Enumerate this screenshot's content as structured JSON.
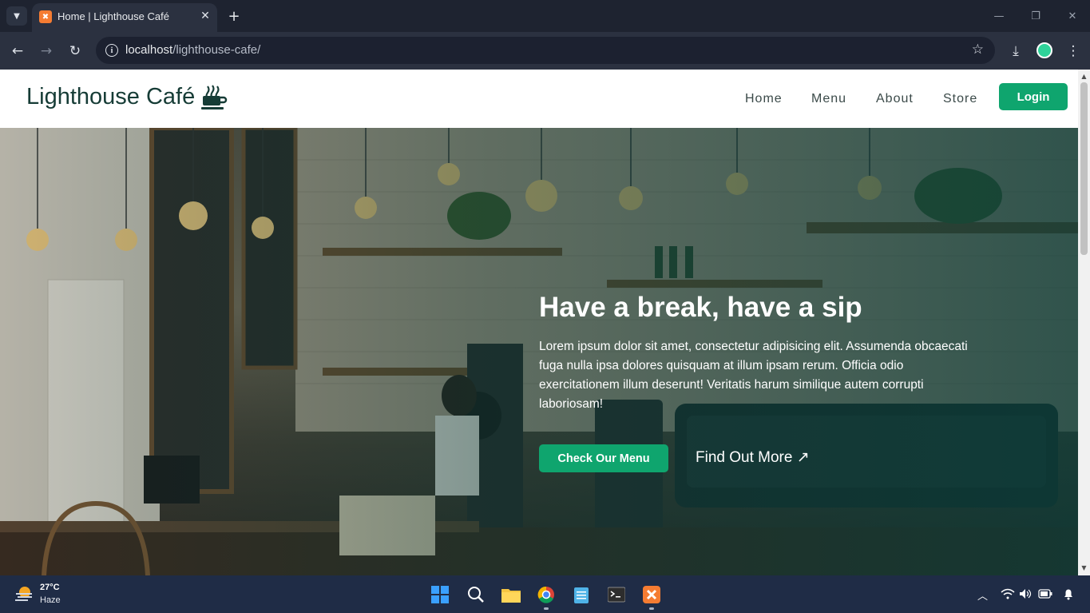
{
  "browser": {
    "tab_title": "Home | Lighthouse Café",
    "url_host": "localhost",
    "url_path": "/lighthouse-cafe/",
    "tab_favicon_icon": "xampp-icon"
  },
  "site": {
    "brand": "Lighthouse Café",
    "nav": {
      "home": "Home",
      "menu": "Menu",
      "about": "About",
      "store": "Store",
      "login": "Login"
    },
    "hero": {
      "title": "Have a break, have a sip",
      "text": "Lorem ipsum dolor sit amet, consectetur adipisicing elit. Assumenda obcaecati fuga nulla ipsa dolores quisquam at illum ipsam rerum. Officia odio exercitationem illum deserunt! Veritatis harum similique autem corrupti laboriosam!",
      "cta": "Check Our Menu",
      "secondary": "Find Out More ↗"
    }
  },
  "colors": {
    "accent_green": "#0fa56e",
    "brand_dark": "#163c36",
    "taskbar": "#1f2c46"
  },
  "taskbar": {
    "temperature": "27°C",
    "condition": "Haze"
  }
}
